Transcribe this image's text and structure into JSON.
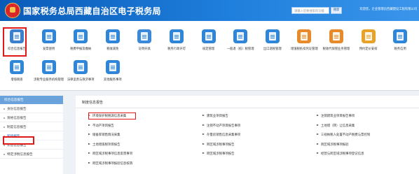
{
  "header": {
    "title": "国家税务总局西藏自治区电子税务局",
    "search_placeholder": "请输入您要搜索的功能",
    "search_button": "搜索",
    "account": "欢迎您，企业管理员西藏建设工程有限公司"
  },
  "services": [
    {
      "label": "综合信息报告",
      "color": "#3b7fd0",
      "icon": "report-icon"
    },
    {
      "label": "发票使用",
      "color": "#2f86d8",
      "icon": "invoice-icon"
    },
    {
      "label": "税费申报及缴纳",
      "color": "#2f86d8",
      "icon": "tax-declare-icon"
    },
    {
      "label": "税收减免",
      "color": "#2f86d8",
      "icon": "tax-relief-icon"
    },
    {
      "label": "证明开具",
      "color": "#3a8ad9",
      "icon": "certificate-icon"
    },
    {
      "label": "税务行政许可",
      "color": "#2f86d8",
      "icon": "permit-icon"
    },
    {
      "label": "核定管理",
      "color": "#2f86d8",
      "icon": "approval-icon"
    },
    {
      "label": "一般退（抵）税管理",
      "color": "#2f86d8",
      "icon": "refund-icon"
    },
    {
      "label": "出口退税管理",
      "color": "#2f86d8",
      "icon": "export-refund-icon"
    },
    {
      "label": "增值税抵扣凭证管理",
      "color": "#e88a2a",
      "icon": "voucher-icon"
    },
    {
      "label": "税收代保管业务管理",
      "color": "#e88a2a",
      "icon": "custody-icon"
    },
    {
      "label": "预约定价安排",
      "color": "#e8a22a",
      "icon": "pricing-icon"
    },
    {
      "label": "税务信用",
      "color": "#2f86d8",
      "icon": "credit-icon"
    },
    {
      "label": "增值税查",
      "color": "#2f86d8",
      "icon": "vat-check-icon"
    },
    {
      "label": "涉税专业服务机构管理",
      "color": "#2f86d8",
      "icon": "agency-icon"
    },
    {
      "label": "法律追责与救济事项",
      "color": "#2f86d8",
      "icon": "legal-icon"
    },
    {
      "label": "其他服务事项",
      "color": "#2f86d8",
      "icon": "other-service-icon"
    }
  ],
  "sidebar": {
    "header": "综合信息报告",
    "items": [
      "身份信息报告",
      "资格信息报告",
      "制度信息报告",
      "跨境报告",
      "状态信息报告",
      "特定涉税信息报告"
    ]
  },
  "main": {
    "title": "制度信息报告",
    "links": [
      "环境保护税税源信息采集",
      "建筑业项目报告",
      "注销建筑业项目报告事项",
      "不动产项目报告",
      "注销不动产项目报告事项",
      "土地增（转）让信息采集",
      "储备库销售情况采集",
      "存量房销售信息采集事项",
      "三视纳税人处置不动产税费与票控制",
      "土地增值税项目报告",
      "跨区域涉税事项报告",
      "跨区域涉税事项报验",
      "跨区域涉税事项信息反馈事项",
      "跨区域涉税事项报告",
      "经营与跨区域涉税事项登记信息",
      "跨区域涉税事项报验信息核销"
    ]
  }
}
